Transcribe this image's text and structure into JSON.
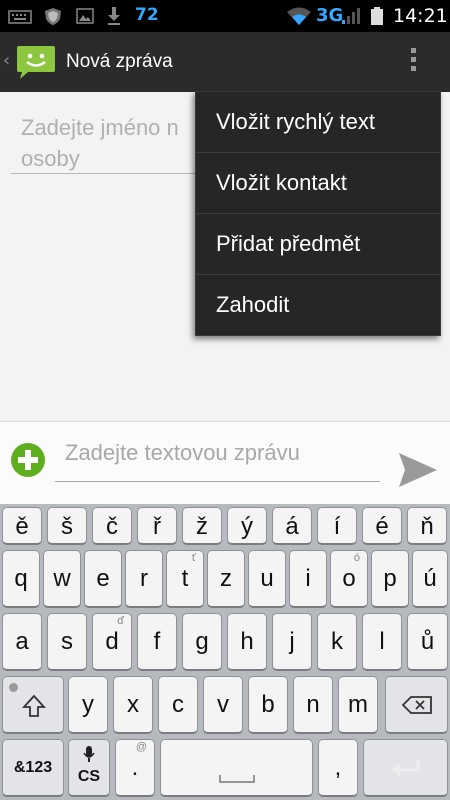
{
  "status_bar": {
    "battery_percent": "72",
    "network": "3G",
    "time": "14:21"
  },
  "action_bar": {
    "title": "Nová zpráva"
  },
  "recipient": {
    "placeholder": "Zadejte jméno nebo číslo osoby",
    "visible_text": "Zadejte jméno n",
    "visible_text_line2": "osoby"
  },
  "compose": {
    "placeholder": "Zadejte textovou zprávu"
  },
  "menu": {
    "items": [
      {
        "label": "Vložit rychlý text"
      },
      {
        "label": "Vložit kontakt"
      },
      {
        "label": "Přidat předmět"
      },
      {
        "label": "Zahodit"
      }
    ]
  },
  "keyboard": {
    "row1": [
      "ě",
      "š",
      "č",
      "ř",
      "ž",
      "ý",
      "á",
      "í",
      "é",
      "ň"
    ],
    "row2": [
      {
        "k": "q",
        "h": ""
      },
      {
        "k": "w",
        "h": ""
      },
      {
        "k": "e",
        "h": ""
      },
      {
        "k": "r",
        "h": ""
      },
      {
        "k": "t",
        "h": "ť"
      },
      {
        "k": "z",
        "h": ""
      },
      {
        "k": "u",
        "h": ""
      },
      {
        "k": "i",
        "h": ""
      },
      {
        "k": "o",
        "h": "ó"
      },
      {
        "k": "p",
        "h": ""
      },
      {
        "k": "ú",
        "h": ""
      }
    ],
    "row3": [
      {
        "k": "a",
        "h": ""
      },
      {
        "k": "s",
        "h": ""
      },
      {
        "k": "d",
        "h": "ď"
      },
      {
        "k": "f",
        "h": ""
      },
      {
        "k": "g",
        "h": ""
      },
      {
        "k": "h",
        "h": ""
      },
      {
        "k": "j",
        "h": ""
      },
      {
        "k": "k",
        "h": ""
      },
      {
        "k": "l",
        "h": ""
      },
      {
        "k": "ů",
        "h": ""
      }
    ],
    "row4": [
      "y",
      "x",
      "c",
      "v",
      "b",
      "n",
      "m"
    ],
    "symbols_label": "&123",
    "language_label": "CS",
    "period_label": ".",
    "period_hint": "@",
    "comma_label": ","
  },
  "colors": {
    "accent_blue": "#35a7ff",
    "add_green": "#5fae1e",
    "menu_bg": "#262626",
    "keyboard_bg": "#b6b9be"
  }
}
